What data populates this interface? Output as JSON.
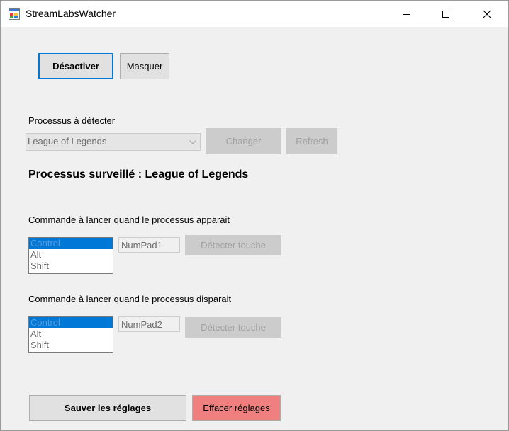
{
  "window": {
    "title": "StreamLabsWatcher"
  },
  "toolbar": {
    "deactivate_label": "Désactiver",
    "hide_label": "Masquer"
  },
  "process": {
    "label": "Processus à détecter",
    "selected": "League of Legends",
    "change_label": "Changer",
    "refresh_label": "Refresh",
    "monitored_text": "Processus surveillé : League of Legends"
  },
  "appear": {
    "label": "Commande à lancer quand le processus apparait",
    "modifiers": [
      "Control",
      "Alt",
      "Shift"
    ],
    "key": "NumPad1",
    "detect_label": "Détecter touche"
  },
  "disappear": {
    "label": "Commande à lancer quand le processus disparait",
    "modifiers": [
      "Control",
      "Alt",
      "Shift"
    ],
    "key": "NumPad2",
    "detect_label": "Détecter touche"
  },
  "footer": {
    "save_label": "Sauver les réglages",
    "clear_label": "Effacer réglages"
  },
  "colors": {
    "accent": "#0078d7",
    "clear_button": "#f08080"
  }
}
